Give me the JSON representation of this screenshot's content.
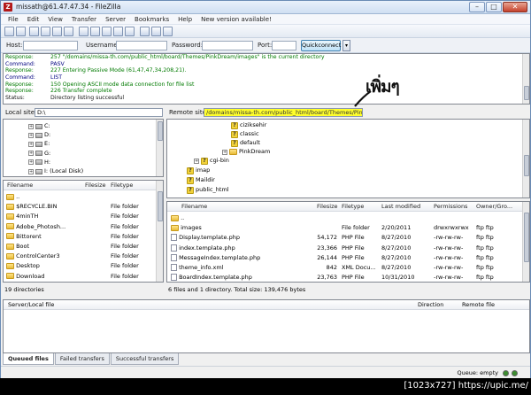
{
  "window": {
    "title": "missath@61.47.47.34 - FileZilla",
    "app_icon": "Z",
    "buttons": {
      "min": "–",
      "max": "□",
      "close": "✕"
    }
  },
  "menu": [
    "File",
    "Edit",
    "View",
    "Transfer",
    "Server",
    "Bookmarks",
    "Help",
    "New version available!"
  ],
  "quickconnect": {
    "host_label": "Host:",
    "username_label": "Username:",
    "password_label": "Password:",
    "port_label": "Port:",
    "button": "Quickconnect",
    "dropdown": "▾"
  },
  "log": [
    {
      "kind": "Response:",
      "text": "257 \"/domains/missa-th.com/public_html/board/Themes/PinkDream/images\" is the current directory",
      "color": "green"
    },
    {
      "kind": "Command:",
      "text": "PASV",
      "color": "navy"
    },
    {
      "kind": "Response:",
      "text": "227 Entering Passive Mode (61,47,47,34,208,21).",
      "color": "green"
    },
    {
      "kind": "Command:",
      "text": "LIST",
      "color": "navy"
    },
    {
      "kind": "Response:",
      "text": "150 Opening ASCII mode data connection for file list",
      "color": "green"
    },
    {
      "kind": "Response:",
      "text": "226 Transfer complete",
      "color": "green"
    },
    {
      "kind": "Status:",
      "text": "Directory listing successful",
      "color": "black"
    }
  ],
  "local": {
    "label": "Local site:",
    "path": "D:\\",
    "tree": [
      {
        "expander": "+",
        "label": "C:"
      },
      {
        "expander": "+",
        "label": "D:"
      },
      {
        "expander": "+",
        "label": "E:"
      },
      {
        "expander": "+",
        "label": "G:"
      },
      {
        "expander": "+",
        "label": "H:"
      },
      {
        "expander": "+",
        "label": "I: (Local Disk)"
      }
    ],
    "columns": [
      "Filename",
      "Filesize",
      "Filetype"
    ],
    "rows": [
      {
        "name": "..",
        "type": ""
      },
      {
        "name": "$RECYCLE.BIN",
        "type": "File folder"
      },
      {
        "name": "4minTH",
        "type": "File folder"
      },
      {
        "name": "Adobe_Photosh...",
        "type": "File folder"
      },
      {
        "name": "Bittorent",
        "type": "File folder"
      },
      {
        "name": "Boot",
        "type": "File folder"
      },
      {
        "name": "ControlCenter3",
        "type": "File folder"
      },
      {
        "name": "Desktop",
        "type": "File folder"
      },
      {
        "name": "Download",
        "type": "File folder"
      }
    ],
    "status": "19 directories"
  },
  "remote": {
    "label": "Remote site:",
    "path": "/domains/missa-th.com/public_html/board/Themes/PinkDream",
    "tree": [
      {
        "expander": "",
        "label": "ciziksehir",
        "icon": "question"
      },
      {
        "expander": "",
        "label": "classic",
        "icon": "question"
      },
      {
        "expander": "",
        "label": "default",
        "icon": "question"
      },
      {
        "expander": "+",
        "label": "PinkDream",
        "icon": "folder"
      },
      {
        "expander": "+",
        "label": "cgi-bin",
        "icon": "question"
      },
      {
        "expander": "",
        "label": "imap",
        "icon": "question"
      },
      {
        "expander": "",
        "label": "Maildir",
        "icon": "question"
      },
      {
        "expander": "",
        "label": "public_html",
        "icon": "question"
      }
    ],
    "columns": [
      "Filename",
      "Filesize",
      "Filetype",
      "Last modified",
      "Permissions",
      "Owner/Gro..."
    ],
    "rows": [
      {
        "name": "..",
        "size": "",
        "type": "",
        "modified": "",
        "perm": "",
        "owner": "",
        "icon": "folder"
      },
      {
        "name": "images",
        "size": "",
        "type": "File folder",
        "modified": "2/20/2011",
        "perm": "drwxrwxrwx",
        "owner": "ftp ftp",
        "icon": "folder"
      },
      {
        "name": "Display.template.php",
        "size": "54,172",
        "type": "PHP File",
        "modified": "8/27/2010",
        "perm": "-rw-rw-rw-",
        "owner": "ftp ftp",
        "icon": "file"
      },
      {
        "name": "index.template.php",
        "size": "23,366",
        "type": "PHP File",
        "modified": "8/27/2010",
        "perm": "-rw-rw-rw-",
        "owner": "ftp ftp",
        "icon": "file"
      },
      {
        "name": "MessageIndex.template.php",
        "size": "26,144",
        "type": "PHP File",
        "modified": "8/27/2010",
        "perm": "-rw-rw-rw-",
        "owner": "ftp ftp",
        "icon": "file"
      },
      {
        "name": "theme_info.xml",
        "size": "842",
        "type": "XML Docu...",
        "modified": "8/27/2010",
        "perm": "-rw-rw-rw-",
        "owner": "ftp ftp",
        "icon": "file"
      },
      {
        "name": "BoardIndex.template.php",
        "size": "23,763",
        "type": "PHP File",
        "modified": "10/31/2010",
        "perm": "-rw-rw-rw-",
        "owner": "ftp ftp",
        "icon": "file"
      }
    ],
    "status": "6 files and 1 directory. Total size: 139,476 bytes"
  },
  "queue": {
    "columns": [
      "Server/Local file",
      "Direction",
      "Remote file"
    ],
    "tabs": [
      "Queued files",
      "Failed transfers",
      "Successful transfers"
    ],
    "status": "Queue: empty"
  },
  "annotation": "เพิ่มๆ",
  "watermark": "[1023x727] https://upic.me/",
  "colors": {
    "highlight": "#ffff2b",
    "response": "#007a00",
    "command": "#000080"
  }
}
